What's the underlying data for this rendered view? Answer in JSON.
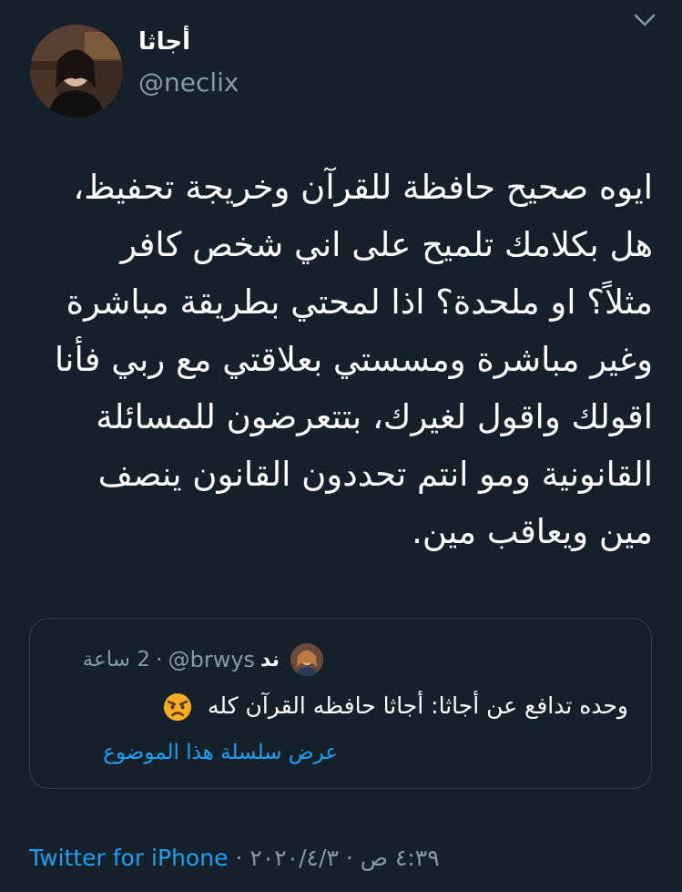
{
  "tweet": {
    "author": {
      "display_name": "أجاثا",
      "handle": "@neclix",
      "avatar_icon": "profile-photo"
    },
    "text_lines": [
      "ايوه صحيح حافظة للقرآن وخريجة تحفيظ،",
      "هل بكلامك تلميح على اني شخص كافر",
      "مثلاً؟ او ملحدة؟ اذا لمحتي بطريقة مباشرة",
      "وغير مباشرة ومسستي بعلاقتي مع ربي فأنا",
      "اقولك واقول لغيرك، بتتعرضون للمسائلة",
      "القانونية ومو انتم تحددون القانون ينصف",
      "مين ويعاقب مين."
    ],
    "quoted": {
      "display_name": "ند",
      "handle": "@brwys",
      "separator": "·",
      "time_ago": "2 ساعة",
      "text": "وحده تدافع عن أجاثا: أجاثا حافظه القرآن كله",
      "emoji": "angry-face",
      "show_thread": "عرض سلسلة هذا الموضوع"
    },
    "footer": {
      "time": "٤:٣٩ ص",
      "separator": "·",
      "date": "٢٠٢٠/٤/٣",
      "source": "Twitter for iPhone"
    },
    "menu_icon": "chevron-down-icon"
  },
  "colors": {
    "background": "#15202b",
    "text": "#ffffff",
    "secondary": "#8899a6",
    "link": "#1da1f2",
    "border": "#38444d"
  }
}
